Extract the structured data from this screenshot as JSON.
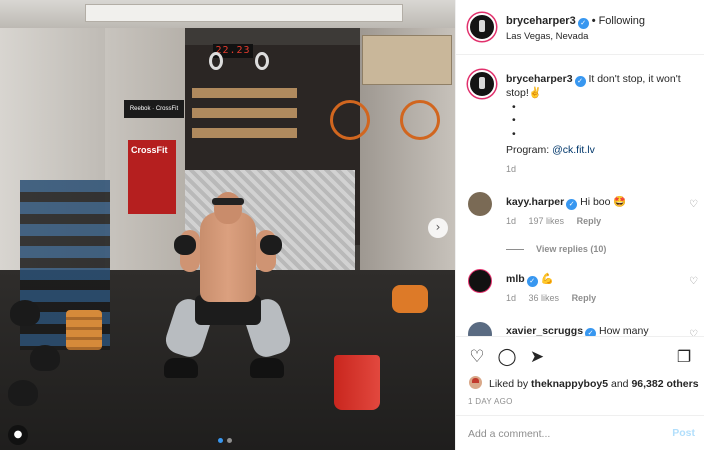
{
  "post": {
    "username": "bryceharper3",
    "follow_status": "Following",
    "location": "Las Vegas, Nevada",
    "caption_username": "bryceharper3",
    "caption_text": "It don't stop, it won't stop!✌️",
    "caption_bullets": [
      "•",
      "•",
      "•"
    ],
    "caption_program_prefix": "Program:",
    "caption_program_link": "@ck.fit.lv",
    "caption_age": "1d"
  },
  "photo": {
    "timer_display": "22.23",
    "banner_text": "CrossFit",
    "brand_text": "Reebok · CrossFit",
    "carousel_count": 2,
    "carousel_active_index": 0
  },
  "comments": [
    {
      "username": "kayy.harper",
      "verified": true,
      "text": "Hi boo 🤩",
      "age": "1d",
      "likes": "197 likes",
      "reply_label": "Reply",
      "view_replies": "View replies (10)",
      "avatar_color": "#7a6a55"
    },
    {
      "username": "mlb",
      "verified": true,
      "text": "💪",
      "age": "1d",
      "likes": "36 likes",
      "reply_label": "Reply",
      "avatar_color": "#111111"
    },
    {
      "username": "xavier_scruggs",
      "verified": true,
      "text": "How many",
      "avatar_color": "#5a6b82"
    }
  ],
  "actions": {
    "like_icon": "heart-icon",
    "comment_icon": "comment-icon",
    "share_icon": "share-icon",
    "save_icon": "bookmark-icon",
    "liked_by_prefix": "Liked by",
    "liked_by_user": "theknappyboy5",
    "liked_by_and": "and",
    "others_count": "96,382 others",
    "timestamp": "1 DAY AGO"
  },
  "comment_box": {
    "placeholder": "Add a comment...",
    "post_label": "Post"
  },
  "colors": {
    "verified_blue": "#3897f0",
    "link": "#00376b",
    "muted": "#8e8e8e",
    "post_disabled": "#b2dffc",
    "story_ring": "#e1306c"
  }
}
